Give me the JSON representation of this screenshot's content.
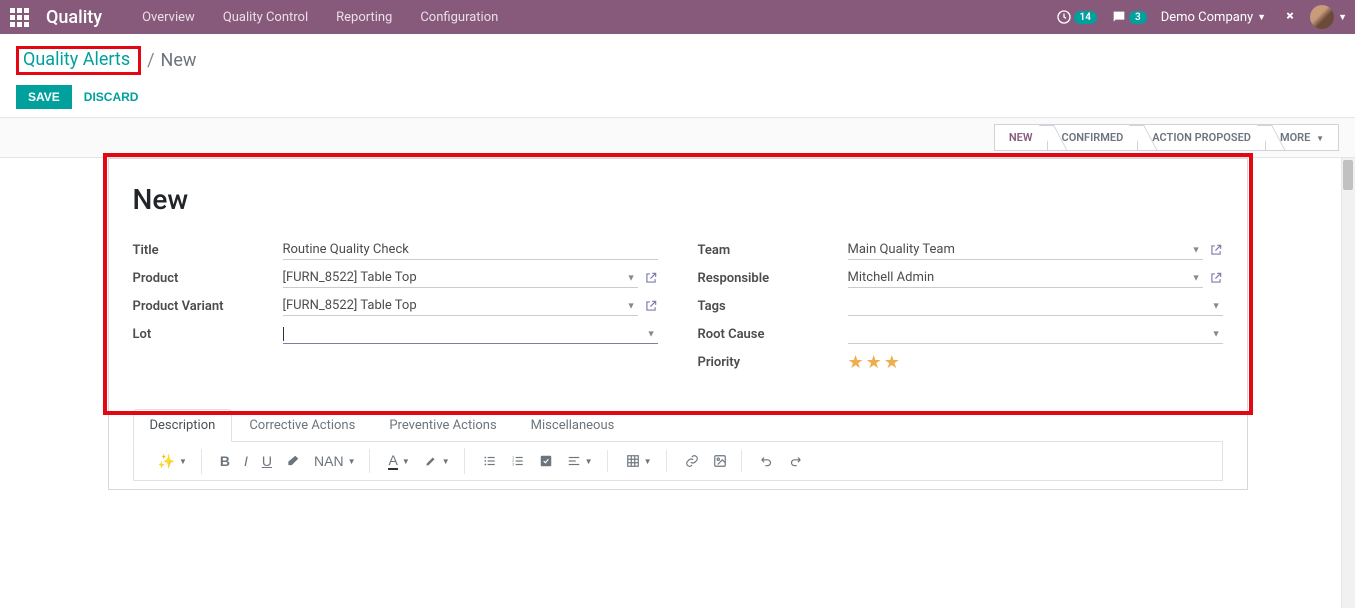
{
  "navbar": {
    "brand": "Quality",
    "links": [
      "Overview",
      "Quality Control",
      "Reporting",
      "Configuration"
    ],
    "clock_badge": "14",
    "chat_badge": "3",
    "company": "Demo Company"
  },
  "breadcrumb": {
    "parent": "Quality Alerts",
    "current": "New"
  },
  "actions": {
    "save": "SAVE",
    "discard": "DISCARD"
  },
  "status": {
    "items": [
      "NEW",
      "CONFIRMED",
      "ACTION PROPOSED"
    ],
    "more": "MORE",
    "active_index": 0
  },
  "form": {
    "title": "New",
    "left": {
      "title_label": "Title",
      "title_value": "Routine Quality Check",
      "product_label": "Product",
      "product_value": "[FURN_8522] Table Top",
      "variant_label": "Product Variant",
      "variant_value": "[FURN_8522] Table Top",
      "lot_label": "Lot",
      "lot_value": ""
    },
    "right": {
      "team_label": "Team",
      "team_value": "Main Quality Team",
      "responsible_label": "Responsible",
      "responsible_value": "Mitchell Admin",
      "tags_label": "Tags",
      "tags_value": "",
      "root_label": "Root Cause",
      "root_value": "",
      "priority_label": "Priority",
      "priority_stars": 3
    }
  },
  "tabs": [
    "Description",
    "Corrective Actions",
    "Preventive Actions",
    "Miscellaneous"
  ],
  "toolbar": {
    "nan": "NAN"
  }
}
